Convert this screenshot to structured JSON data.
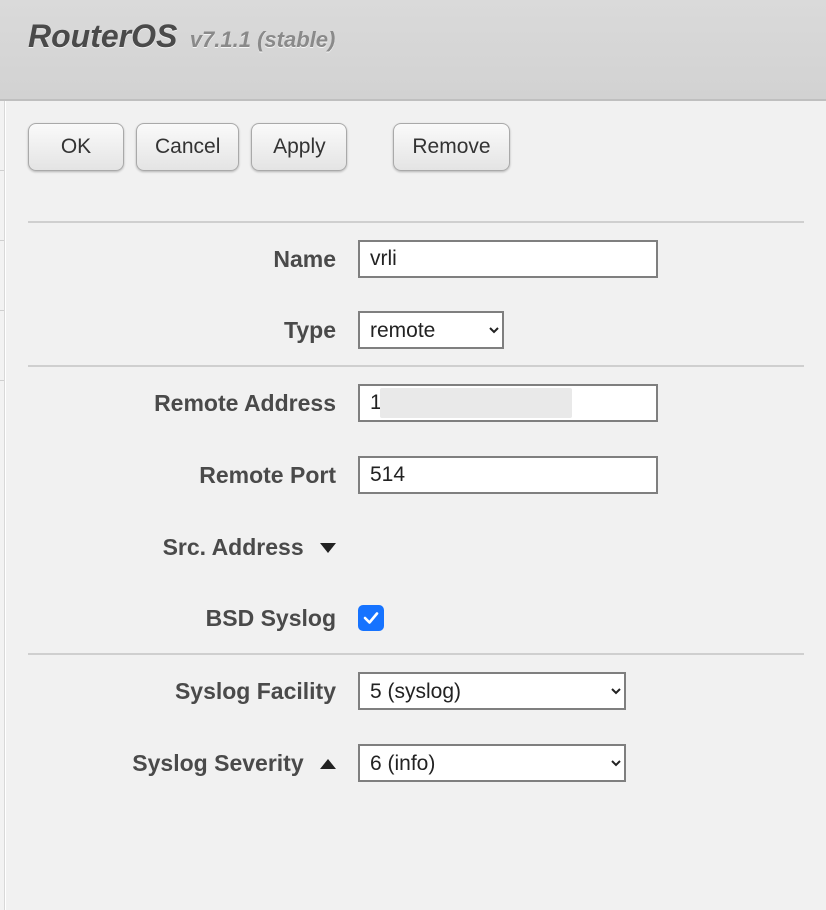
{
  "header": {
    "title": "RouterOS",
    "version": "v7.1.1 (stable)"
  },
  "toolbar": {
    "ok": "OK",
    "cancel": "Cancel",
    "apply": "Apply",
    "remove": "Remove"
  },
  "form": {
    "name_label": "Name",
    "name_value": "vrli",
    "type_label": "Type",
    "type_value": "remote",
    "remote_address_label": "Remote Address",
    "remote_address_value": "1",
    "remote_port_label": "Remote Port",
    "remote_port_value": "514",
    "src_address_label": "Src. Address",
    "bsd_syslog_label": "BSD Syslog",
    "bsd_syslog_checked": true,
    "syslog_facility_label": "Syslog Facility",
    "syslog_facility_value": "5 (syslog)",
    "syslog_severity_label": "Syslog Severity",
    "syslog_severity_value": "6 (info)"
  }
}
